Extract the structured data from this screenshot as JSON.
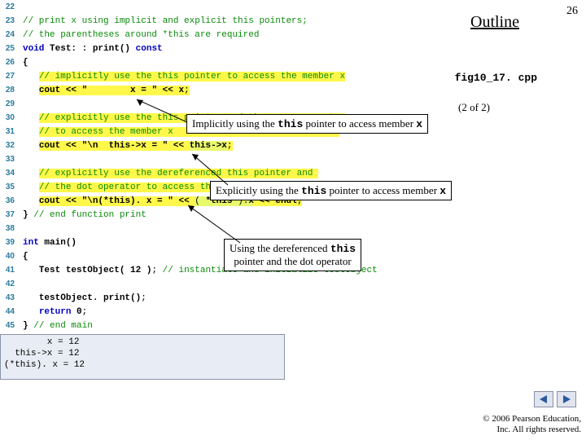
{
  "header": {
    "outline": "Outline",
    "page_number": "26",
    "fig_label": "fig10_17. cpp",
    "page_pos": "(2 of 2)"
  },
  "code": [
    {
      "n": "22",
      "html": ""
    },
    {
      "n": "23",
      "html": "<span class='cm'>// print x using implicit and explicit this pointers;</span>"
    },
    {
      "n": "24",
      "html": "<span class='cm'>// the parentheses around *this are required</span>"
    },
    {
      "n": "25",
      "html": "<span class='kw'>void</span> <span class='id'>Test: : print()</span> <span class='kw'>const</span>"
    },
    {
      "n": "26",
      "html": "<span class='id'>{</span>"
    },
    {
      "n": "27",
      "html": "   <span class='hl'><span class='cm'>// implicitly use the this pointer to access the member x</span></span>"
    },
    {
      "n": "28",
      "html": "   <span class='hl'><span class='id'>cout</span> <span class='op'>&lt;&lt;</span> <span class='st'>\"        x = \"</span> <span class='op'>&lt;&lt;</span> <span class='id'>x</span>;</span>"
    },
    {
      "n": "29",
      "html": ""
    },
    {
      "n": "30",
      "html": "   <span class='hl'><span class='cm'>// explicitly use the this pointer and the arrow operator</span></span>"
    },
    {
      "n": "31",
      "html": "   <span class='hl'><span class='cm'>// to access the member x</span>                               </span>"
    },
    {
      "n": "32",
      "html": "   <span class='hl'><span class='id'>cout</span> <span class='op'>&lt;&lt;</span> <span class='st'>\"\\n  this-&gt;x = \"</span> <span class='op'>&lt;&lt;</span> <span class='hlg'><span class='id'>this-&gt;x</span></span>;</span>"
    },
    {
      "n": "33",
      "html": ""
    },
    {
      "n": "34",
      "html": "   <span class='hl'><span class='cm'>// explicitly use the dereferenced this pointer and </span></span>"
    },
    {
      "n": "35",
      "html": "   <span class='hl'><span class='cm'>// the dot operator to access the member x</span>          </span>"
    },
    {
      "n": "36",
      "html": "   <span class='hl'><span class='id'>cout</span> <span class='op'>&lt;&lt;</span> <span class='st'>\"\\n(*this). x = \"</span> <span class='op'>&lt;&lt;</span> <span class='hlg'>( <span class='id'>*this</span> ).<span class='id'>x</span></span> <span class='op'>&lt;&lt;</span> <span class='id'>endl</span>;</span>"
    },
    {
      "n": "37",
      "html": "<span class='id'>}</span> <span class='cm'>// end function print</span>"
    },
    {
      "n": "38",
      "html": ""
    },
    {
      "n": "39",
      "html": "<span class='kw'>int</span> <span class='id'>main()</span>"
    },
    {
      "n": "40",
      "html": "<span class='id'>{</span>"
    },
    {
      "n": "41",
      "html": "   <span class='id'>Test testObject(</span> <span class='num'>12</span> <span class='id'>)</span>; <span class='cm'>// instantiate and initialize testObject</span>"
    },
    {
      "n": "42",
      "html": ""
    },
    {
      "n": "43",
      "html": "   <span class='id'>testObject. print()</span>;"
    },
    {
      "n": "44",
      "html": "   <span class='kw'>return</span> <span class='num'>0</span>;"
    },
    {
      "n": "45",
      "html": "<span class='id'>}</span> <span class='cm'>// end main</span>"
    }
  ],
  "output": "        x = 12\n  this->x = 12\n(*this). x = 12",
  "callouts": {
    "c1_pre": "Implicitly using the ",
    "c1_mono": "this",
    "c1_mid": " pointer to access member ",
    "c1_mono2": "x",
    "c2_pre": "Explicitly using the ",
    "c2_mono": "this",
    "c2_mid": " pointer to access member ",
    "c2_mono2": "x",
    "c3_l1a": "Using the dereferenced ",
    "c3_l1b": "this",
    "c3_l2": "pointer and the dot operator"
  },
  "footer": {
    "l1": "© 2006 Pearson Education,",
    "l2": "Inc.  All rights reserved."
  }
}
